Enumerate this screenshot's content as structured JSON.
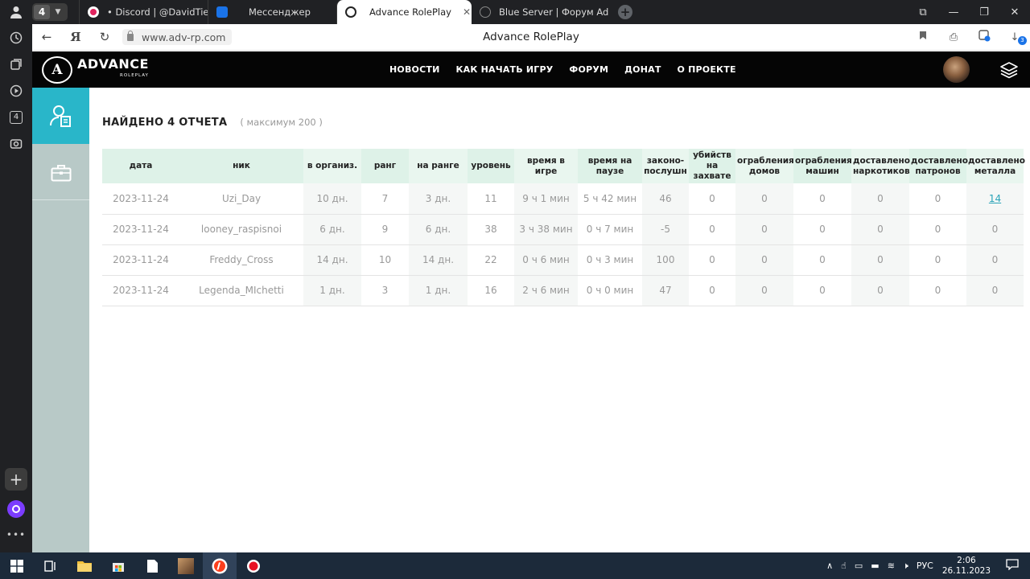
{
  "browser": {
    "tab_count": "4",
    "tabs": [
      {
        "title": "• Discord | @DavidTienda",
        "icon": "discord-icon",
        "color": "#5865f2"
      },
      {
        "title": "Мессенджер",
        "icon": "messenger-icon",
        "color": "#1a73e8"
      },
      {
        "title": "Advance RolePlay",
        "icon": "advance-logo-icon",
        "color": "#222222",
        "active": true
      },
      {
        "title": "Blue Server | Форум Advar",
        "icon": "globe-icon",
        "color": "#666666"
      }
    ],
    "url": "www.adv-rp.com",
    "page_title": "Advance RolePlay",
    "downloads_badge": "3",
    "rail_badge": "4"
  },
  "site": {
    "logo_text": "ADVANCE",
    "logo_subtext": "ROLEPLAY",
    "logo_mark": "A",
    "nav": [
      "НОВОСТИ",
      "КАК НАЧАТЬ ИГРУ",
      "ФОРУМ",
      "ДОНАТ",
      "О ПРОЕКТЕ"
    ]
  },
  "colors": {
    "accent": "#29b6c9",
    "header_bg": "#050505",
    "sidebar_bg": "#b8c9c7",
    "table_header": "#def2e8"
  },
  "report": {
    "title": "НАЙДЕНО 4 ОТЧЕТА",
    "max_note": "( максимум 200 )",
    "columns": [
      "дата",
      "ник",
      "в организ.",
      "ранг",
      "на ранге",
      "уровень",
      "время в игре",
      "время на паузе",
      "законо-послушн",
      "убийств на захвате",
      "ограбления домов",
      "ограбления машин",
      "доставлено наркотиков",
      "доставлено патронов",
      "доставлено металла"
    ],
    "rows": [
      [
        "2023-11-24",
        "Uzi_Day",
        "10 дн.",
        "7",
        "3 дн.",
        "11",
        "9 ч 1 мин",
        "5 ч 42 мин",
        "46",
        "0",
        "0",
        "0",
        "0",
        "0",
        "14"
      ],
      [
        "2023-11-24",
        "looney_raspisnoi",
        "6 дн.",
        "9",
        "6 дн.",
        "38",
        "3 ч 38 мин",
        "0 ч 7 мин",
        "-5",
        "0",
        "0",
        "0",
        "0",
        "0",
        "0"
      ],
      [
        "2023-11-24",
        "Freddy_Cross",
        "14 дн.",
        "10",
        "14 дн.",
        "22",
        "0 ч 6 мин",
        "0 ч 3 мин",
        "100",
        "0",
        "0",
        "0",
        "0",
        "0",
        "0"
      ],
      [
        "2023-11-24",
        "Legenda_MIchetti",
        "1 дн.",
        "3",
        "1 дн.",
        "16",
        "2 ч 6 мин",
        "0 ч 0 мин",
        "47",
        "0",
        "0",
        "0",
        "0",
        "0",
        "0"
      ]
    ]
  },
  "taskbar": {
    "lang": "РУС",
    "time": "2:06",
    "date": "26.11.2023"
  }
}
